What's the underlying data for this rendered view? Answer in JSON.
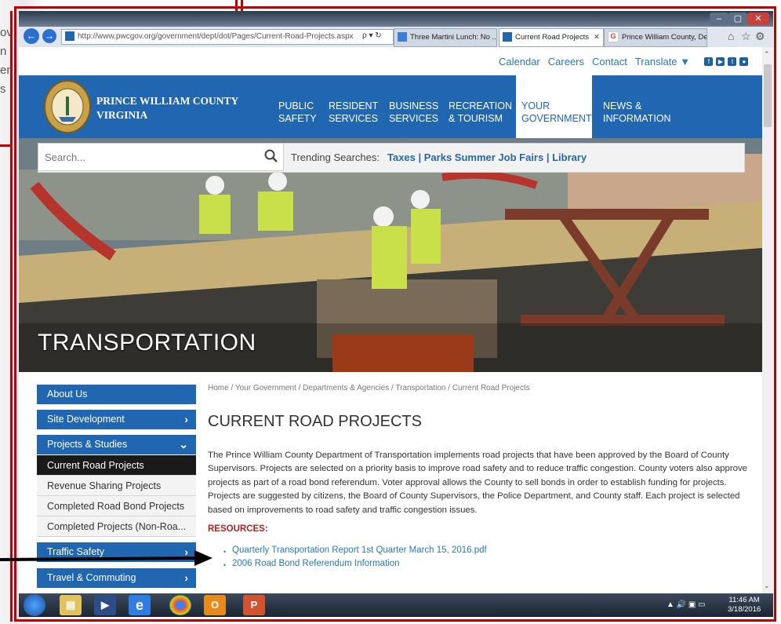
{
  "background_text": [
    "ov",
    "n",
    "en",
    "s"
  ],
  "browser": {
    "url": "http://www.pwcgov.org/government/dept/dot/Pages/Current-Road-Projects.aspx",
    "search_glyph": "ρ ▾ ↻",
    "tabs": [
      {
        "label": "Three Martini Lunch: No ...",
        "icon": "nr-icon",
        "active": false
      },
      {
        "label": "Current Road Projects",
        "icon": "pwc-icon",
        "active": true
      },
      {
        "label": "Prince William County, De...",
        "icon": "google-icon",
        "active": false
      }
    ],
    "tab_close": "✕",
    "right_icons": [
      "⌂",
      "☆",
      "⚙"
    ],
    "window_buttons": [
      "–",
      "▢",
      "✕"
    ]
  },
  "topnav": {
    "links": [
      "Calendar",
      "Careers",
      "Contact",
      "Translate ▼"
    ],
    "social": [
      "f",
      "▶",
      "t",
      "●"
    ]
  },
  "header": {
    "county_line1": "PRINCE WILLIAM COUNTY",
    "county_line2": "VIRGINIA",
    "menu": [
      {
        "line1": "PUBLIC",
        "line2": "SAFETY",
        "active": false
      },
      {
        "line1": "RESIDENT",
        "line2": "SERVICES",
        "active": false
      },
      {
        "line1": "BUSINESS",
        "line2": "SERVICES",
        "active": false
      },
      {
        "line1": "RECREATION",
        "line2": "& TOURISM",
        "active": false
      },
      {
        "line1": "YOUR",
        "line2": "GOVERNMENT",
        "active": true
      },
      {
        "line1": "NEWS &",
        "line2": "INFORMATION",
        "active": false
      }
    ]
  },
  "search": {
    "placeholder": "Search...",
    "trending_label": "Trending Searches:",
    "trending": "Taxes | Parks Summer Job Fairs | Library"
  },
  "hero": {
    "title": "TRANSPORTATION"
  },
  "sidebar": {
    "items": [
      {
        "label": "About Us",
        "chevron": "",
        "kind": "main"
      },
      {
        "label": "Site Development",
        "chevron": "›",
        "kind": "main"
      },
      {
        "label": "Projects & Studies",
        "chevron": "⌄",
        "kind": "main"
      },
      {
        "label": "Current Road Projects",
        "chevron": "",
        "kind": "current"
      },
      {
        "label": "Revenue Sharing Projects",
        "chevron": "",
        "kind": "sub"
      },
      {
        "label": "Completed Road Bond Projects",
        "chevron": "",
        "kind": "sub"
      },
      {
        "label": "Completed Projects (Non-Roa...",
        "chevron": "",
        "kind": "sub"
      },
      {
        "label": "Traffic Safety",
        "chevron": "›",
        "kind": "main"
      },
      {
        "label": "Travel & Commuting",
        "chevron": "›",
        "kind": "main"
      }
    ]
  },
  "main": {
    "breadcrumb": "Home / Your Government / Departments & Agencies / Transportation / Current Road Projects",
    "title": "CURRENT ROAD PROJECTS",
    "body": "The Prince William County Department of Transportation implements road projects that have been approved by the Board of County Supervisors. Projects are selected on a priority basis to improve road safety and to reduce traffic congestion. County voters also approve projects as part of a road bond referendum. Voter approval allows the County to sell bonds in order to establish funding for projects. Projects are suggested by citizens, the Board of County Supervisors, the Police Department, and County staff. Each project is selected based on improvements to road safety and traffic congestion issues.",
    "resources_title": "RESOURCES:",
    "resources": [
      "Quarterly Transportation Report 1st Quarter March 15, 2016.pdf",
      "2006 Road Bond Referendum Information"
    ]
  },
  "taskbar": {
    "icons": [
      "start-orb",
      "explorer",
      "media",
      "ie",
      "chrome",
      "outlook",
      "powerpoint"
    ],
    "time": "11:46 AM",
    "date": "3/18/2016",
    "tray": "▲ 🔊 ▣ ▭"
  },
  "colors": {
    "header_blue": "#2166b1",
    "link_blue": "#2a7ab8",
    "annotation_red": "#c00000",
    "resources_red": "#b22222"
  }
}
